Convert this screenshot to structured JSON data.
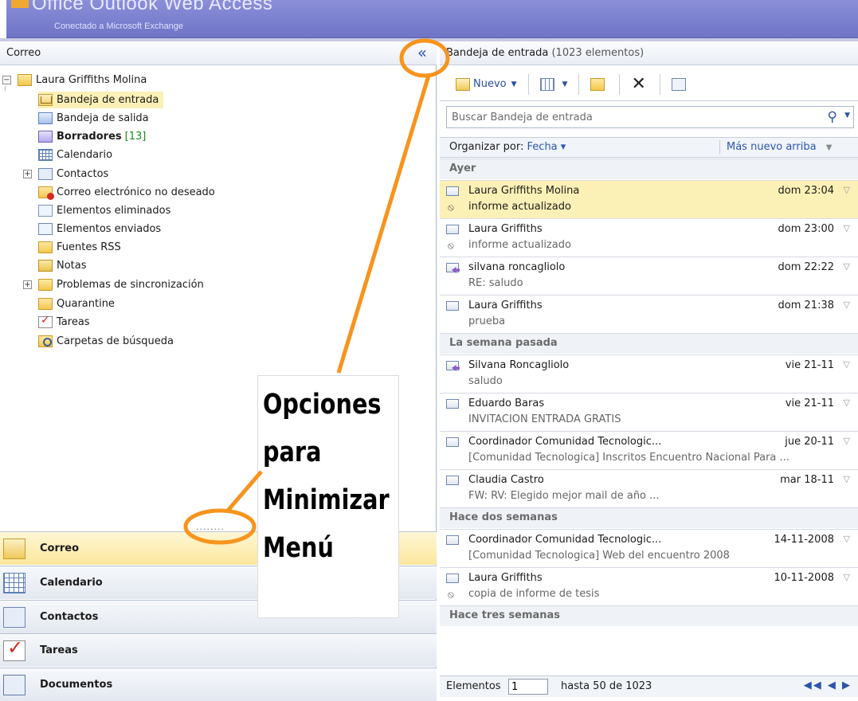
{
  "window": {
    "title": "Office Outlook Web Access",
    "subtitle": "Conectado a Microsoft Exchange"
  },
  "left_pane": {
    "header_label": "Correo",
    "collapse_icon": "«",
    "root": "Laura Griffiths Molina",
    "folders": [
      {
        "label": "Bandeja de entrada",
        "icon": "inbox-icon"
      },
      {
        "label": "Bandeja de salida",
        "icon": "outbox-icon"
      },
      {
        "label": "Borradores",
        "count": "[13]",
        "icon": "drafts-icon"
      },
      {
        "label": "Calendario",
        "icon": "calendar-icon"
      },
      {
        "label": "Contactos",
        "icon": "contacts-icon"
      },
      {
        "label": "Correo electrónico no deseado",
        "icon": "junk-mail-icon"
      },
      {
        "label": "Elementos eliminados",
        "icon": "deleted-items-icon"
      },
      {
        "label": "Elementos enviados",
        "icon": "sent-items-icon"
      },
      {
        "label": "Fuentes RSS",
        "icon": "folder-icon"
      },
      {
        "label": "Notas",
        "icon": "notes-icon"
      },
      {
        "label": "Problemas de sincronización",
        "icon": "folder-icon"
      },
      {
        "label": "Quarantine",
        "icon": "folder-icon"
      },
      {
        "label": "Tareas",
        "icon": "tasks-icon"
      },
      {
        "label": "Carpetas de búsqueda",
        "icon": "search-folder-icon"
      }
    ],
    "splitter": "........",
    "nav": [
      {
        "label": "Correo",
        "icon": "mail-icon"
      },
      {
        "label": "Calendario",
        "icon": "calendar-icon"
      },
      {
        "label": "Contactos",
        "icon": "contacts-icon"
      },
      {
        "label": "Tareas",
        "icon": "tasks-icon"
      },
      {
        "label": "Documentos",
        "icon": "documents-icon"
      }
    ]
  },
  "annotation": {
    "lines": [
      "Opciones",
      "para",
      "Minimizar",
      "Menú"
    ],
    "color": "#f7941d"
  },
  "right_pane": {
    "title": "Bandeja de entrada",
    "count": "(1023 elementos)",
    "toolbar": {
      "new_label": "Nuevo"
    },
    "search_placeholder": "Buscar Bandeja de entrada",
    "arrange_label": "Organizar por:",
    "arrange_value": "Fecha",
    "order_label": "Más nuevo arriba",
    "groups": [
      {
        "label": "Ayer"
      },
      {
        "label": "La semana pasada"
      },
      {
        "label": "Hace dos semanas"
      },
      {
        "label": "Hace tres semanas"
      }
    ],
    "messages": [
      {
        "from": "Laura Griffiths Molina",
        "date": "dom 23:04",
        "subject": "informe actualizado",
        "attachment": true,
        "selected": true
      },
      {
        "from": "Laura Griffiths",
        "date": "dom 23:00",
        "subject": "informe actualizado",
        "attachment": true
      },
      {
        "from": "silvana roncagliolo",
        "date": "dom 22:22",
        "subject": "RE: saludo",
        "replied": true
      },
      {
        "from": "Laura Griffiths",
        "date": "dom 21:38",
        "subject": "prueba"
      },
      {
        "from": "Silvana Roncagliolo",
        "date": "vie 21-11",
        "subject": "saludo",
        "replied": true
      },
      {
        "from": "Eduardo Baras",
        "date": "vie 21-11",
        "subject": "INVITACION ENTRADA GRATIS"
      },
      {
        "from": "Coordinador Comunidad Tecnologic...",
        "date": "jue 20-11",
        "subject": "[Comunidad Tecnologica] Inscritos Encuentro Nacional Para ..."
      },
      {
        "from": "Claudia Castro",
        "date": "mar 18-11",
        "subject": "FW: RV: Elegido mejor mail de año ..."
      },
      {
        "from": "Coordinador Comunidad Tecnologic...",
        "date": "14-11-2008",
        "subject": "[Comunidad Tecnologica] Web del encuentro 2008"
      },
      {
        "from": "Laura Griffiths",
        "date": "10-11-2008",
        "subject": "copia de informe de tesis",
        "attachment": true
      }
    ],
    "footer": {
      "items_label": "Elementos",
      "page_value": "1",
      "range_label": "hasta 50 de 1023",
      "nav_icons": "◀◀ ◀ ▶"
    }
  }
}
